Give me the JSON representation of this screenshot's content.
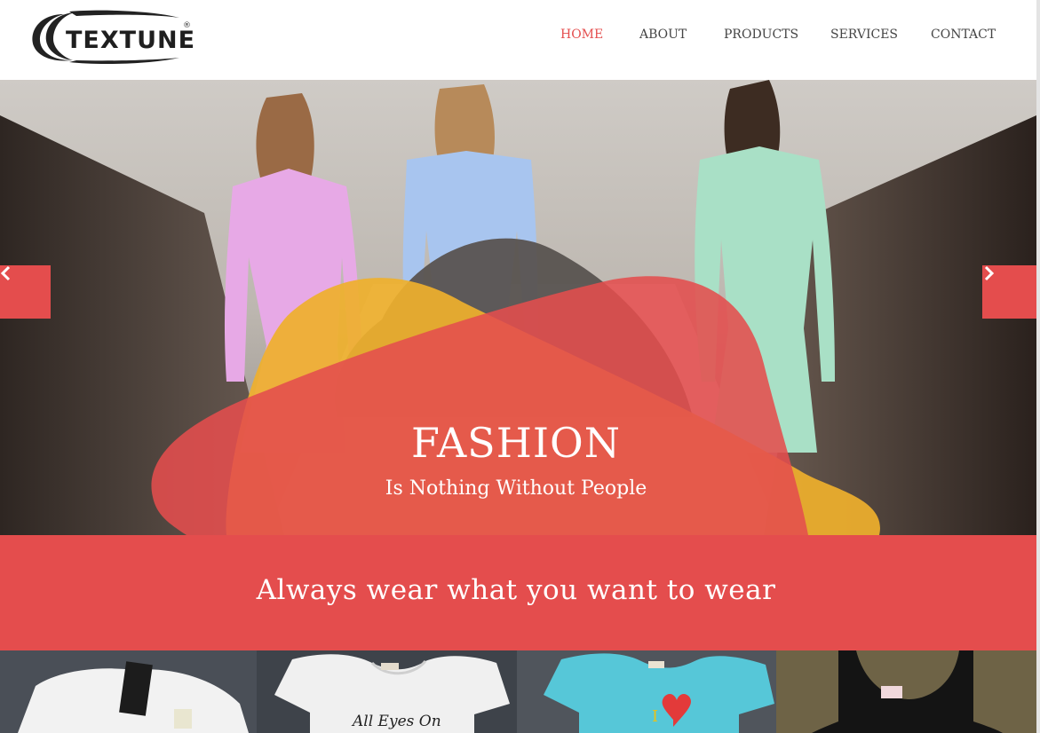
{
  "brand": {
    "name": "TEXTUNE",
    "mark": "®"
  },
  "nav": {
    "items": [
      {
        "label": "HOME",
        "active": true
      },
      {
        "label": "ABOUT",
        "active": false
      },
      {
        "label": "PRODUCTS",
        "active": false
      },
      {
        "label": "SERVICES",
        "active": false
      },
      {
        "label": "CONTACT",
        "active": false
      }
    ]
  },
  "hero": {
    "title": "FASHION",
    "subtitle": "Is Nothing Without People",
    "prev_icon": "chevron-left-icon",
    "next_icon": "chevron-right-icon"
  },
  "banner": {
    "text": "Always wear what you want to wear"
  },
  "gallery": {
    "tiles": [
      {
        "name": "white-tshirt"
      },
      {
        "name": "all-eyes-on-tshirt",
        "print": "All Eyes On"
      },
      {
        "name": "blue-heart-tshirt",
        "print": "I"
      },
      {
        "name": "black-lace-top"
      }
    ]
  },
  "colors": {
    "accent": "#e44d4d",
    "yellow": "#efb02c",
    "dark": "#585350",
    "nav_text": "#444444"
  }
}
